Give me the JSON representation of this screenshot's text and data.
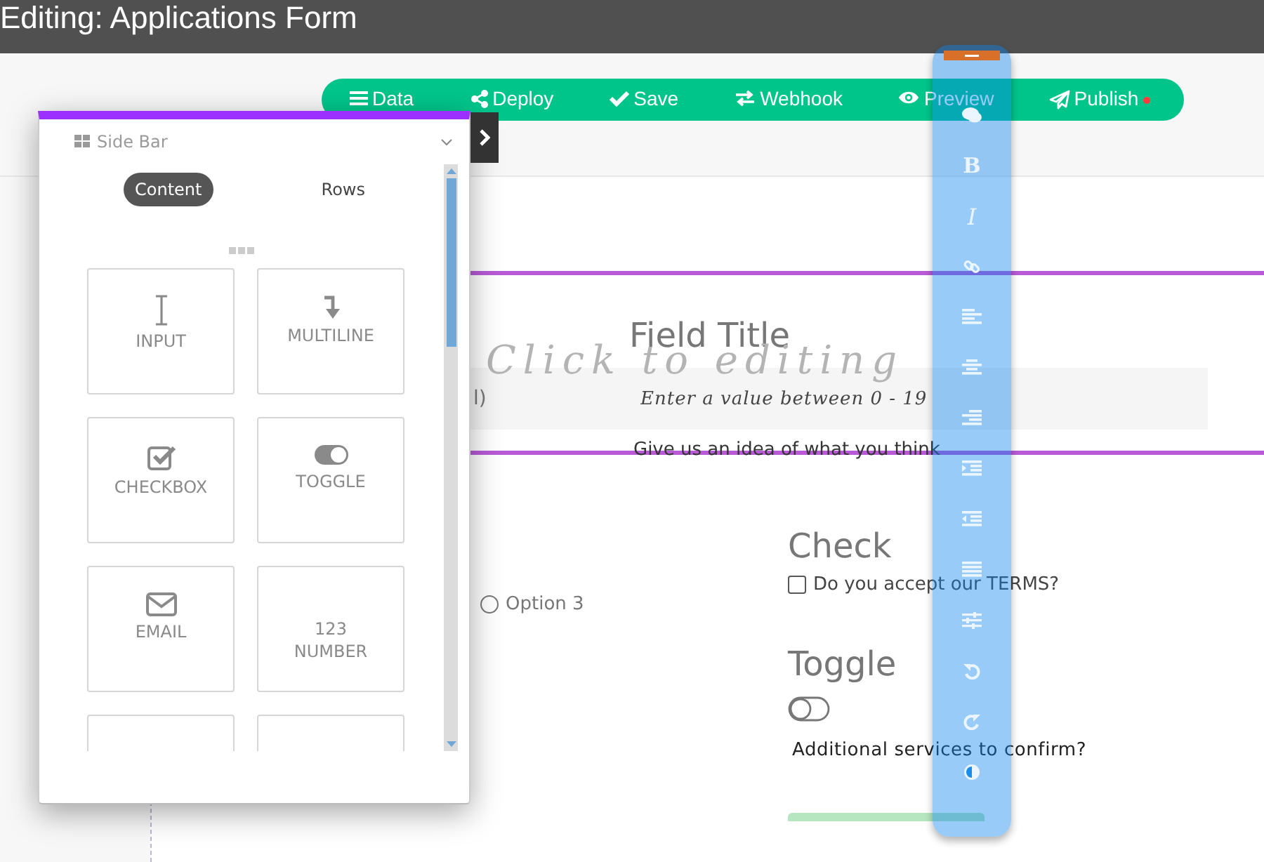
{
  "window": {
    "title": "Editing: Applications Form"
  },
  "action_bar": {
    "buttons": [
      {
        "kind": "data",
        "label": "Data",
        "notification": false
      },
      {
        "kind": "deploy",
        "label": "Deploy",
        "notification": false
      },
      {
        "kind": "save",
        "label": "Save",
        "notification": false
      },
      {
        "kind": "webhook",
        "label": "Webhook",
        "notification": false
      },
      {
        "kind": "preview",
        "label": "Preview",
        "notification": false
      },
      {
        "kind": "publish",
        "label": "Publish",
        "notification": true
      }
    ]
  },
  "side_bar": {
    "title": "Side Bar",
    "tabs": [
      {
        "label": "Content",
        "selected": true
      },
      {
        "label": "Rows",
        "selected": false
      }
    ],
    "elements": [
      {
        "kind": "input",
        "label": "INPUT"
      },
      {
        "kind": "multiline",
        "label": "MULTILINE"
      },
      {
        "kind": "checkbox",
        "label": "CHECKBOX"
      },
      {
        "kind": "toggle",
        "label": "TOGGLE"
      },
      {
        "kind": "email",
        "label": "EMAIL"
      },
      {
        "kind": "number",
        "label": "NUMBER",
        "badge": "123"
      },
      {
        "kind": "partial"
      },
      {
        "kind": "partial"
      }
    ]
  },
  "form": {
    "click_hint": "Click to editing",
    "left_field": {
      "value": "l)"
    },
    "field": {
      "title": "Field Title",
      "placeholder": "Enter a value between 0 - 19",
      "help": "Give us an idea of what you think"
    },
    "radio_options": [
      {
        "label": "Option 3",
        "selected": false
      }
    ],
    "check": {
      "title": "Check",
      "label": "Do you accept our TERMS?",
      "checked": false
    },
    "toggle": {
      "title": "Toggle",
      "label": "Additional services to confirm?",
      "on": false
    }
  },
  "format_toolbar": {
    "buttons": [
      {
        "kind": "comment"
      },
      {
        "kind": "bold",
        "label": "B"
      },
      {
        "kind": "italic",
        "label": "I"
      },
      {
        "kind": "link"
      },
      {
        "kind": "align-left"
      },
      {
        "kind": "align-center"
      },
      {
        "kind": "align-right"
      },
      {
        "kind": "indent"
      },
      {
        "kind": "outdent"
      },
      {
        "kind": "justify"
      },
      {
        "kind": "sliders"
      },
      {
        "kind": "undo"
      },
      {
        "kind": "redo"
      },
      {
        "kind": "contrast"
      }
    ]
  }
}
